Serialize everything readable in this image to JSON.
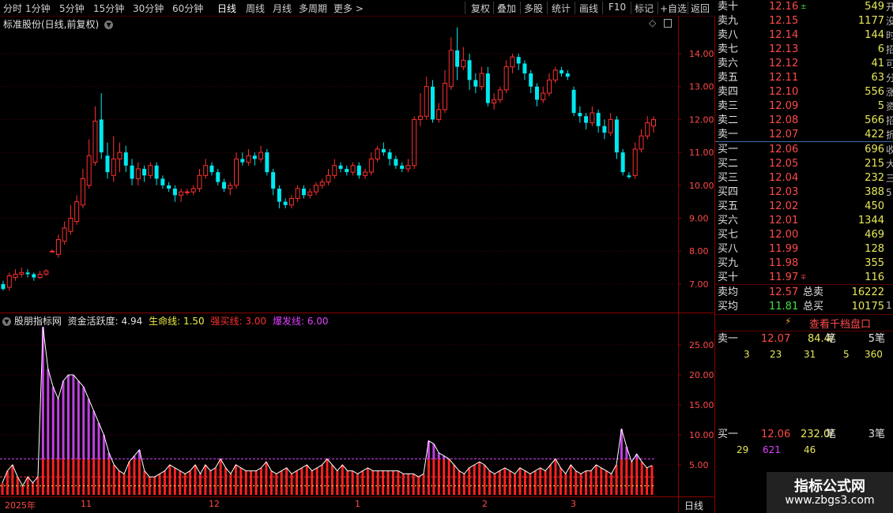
{
  "toolbar": {
    "periods": [
      "分时",
      "1分钟",
      "5分钟",
      "15分钟",
      "30分钟",
      "60分钟",
      "日线",
      "周线",
      "月线",
      "多周期",
      "更多"
    ],
    "active_period": "日线",
    "more_arrow": "chevron-right-icon",
    "actions": [
      "复权",
      "叠加",
      "多股",
      "统计",
      "画线",
      "F10",
      "标记",
      "+自选",
      "返回"
    ]
  },
  "main_chart": {
    "title": "标准股份(日线,前复权)",
    "y_ticks": [
      "14.00",
      "13.00",
      "12.00",
      "11.00",
      "10.00",
      "9.00",
      "8.00",
      "7.00"
    ]
  },
  "indicator": {
    "title": "股朋指标网",
    "fields": [
      {
        "label": "资金活跃度:",
        "value": "4.94",
        "color": "#e0e0e0"
      },
      {
        "label": "生命线:",
        "value": "1.50",
        "color": "#f0f040"
      },
      {
        "label": "强买线:",
        "value": "3.00",
        "color": "#ff3030"
      },
      {
        "label": "爆发线:",
        "value": "6.00",
        "color": "#e040ff"
      }
    ],
    "y_ticks": [
      "25.00",
      "20.00",
      "15.00",
      "10.00",
      "5.00"
    ]
  },
  "date_axis": {
    "labels": [
      "2025年",
      "11",
      "12",
      "1",
      "2",
      "3"
    ],
    "period_label": "日线"
  },
  "chart_data": {
    "type": "candlestick",
    "price_ylim": [
      6.5,
      14.8
    ],
    "candles": [
      [
        7.0,
        6.85,
        7.1,
        6.8
      ],
      [
        6.9,
        7.25,
        7.35,
        6.8
      ],
      [
        7.2,
        7.3,
        7.45,
        7.1
      ],
      [
        7.3,
        7.35,
        7.5,
        7.2
      ],
      [
        7.35,
        7.3,
        7.45,
        7.2
      ],
      [
        7.3,
        7.2,
        7.35,
        7.1
      ],
      [
        7.2,
        7.3,
        7.4,
        7.15
      ],
      [
        7.3,
        7.4,
        7.45,
        7.25
      ],
      [
        8.0,
        8.0,
        8.05,
        7.95
      ],
      [
        7.9,
        8.35,
        8.5,
        7.8
      ],
      [
        8.3,
        8.7,
        8.9,
        8.2
      ],
      [
        8.6,
        9.0,
        9.4,
        8.5
      ],
      [
        8.9,
        9.5,
        9.7,
        8.8
      ],
      [
        9.4,
        10.2,
        10.5,
        9.3
      ],
      [
        10.0,
        10.9,
        11.4,
        9.9
      ],
      [
        10.7,
        11.95,
        12.4,
        10.6
      ],
      [
        12.0,
        11.0,
        12.8,
        10.8
      ],
      [
        10.9,
        10.4,
        11.3,
        10.2
      ],
      [
        10.3,
        10.8,
        11.5,
        10.1
      ],
      [
        10.8,
        11.0,
        11.3,
        10.4
      ],
      [
        11.0,
        10.6,
        11.2,
        10.4
      ],
      [
        10.6,
        10.2,
        10.8,
        10.0
      ],
      [
        10.2,
        10.5,
        10.7,
        10.0
      ],
      [
        10.5,
        10.3,
        10.6,
        10.1
      ],
      [
        10.3,
        10.6,
        10.7,
        10.2
      ],
      [
        10.6,
        10.2,
        10.7,
        10.0
      ],
      [
        10.2,
        10.0,
        10.3,
        9.9
      ],
      [
        10.0,
        9.9,
        10.1,
        9.8
      ],
      [
        9.9,
        9.7,
        10.0,
        9.5
      ],
      [
        9.7,
        9.8,
        9.9,
        9.5
      ],
      [
        9.8,
        9.8,
        9.9,
        9.7
      ],
      [
        9.8,
        9.9,
        10.0,
        9.7
      ],
      [
        9.9,
        10.3,
        10.5,
        9.8
      ],
      [
        10.3,
        10.6,
        10.8,
        10.2
      ],
      [
        10.6,
        10.4,
        10.7,
        10.3
      ],
      [
        10.4,
        10.1,
        10.5,
        10.0
      ],
      [
        10.1,
        9.9,
        10.2,
        9.8
      ],
      [
        9.9,
        10.0,
        10.1,
        9.7
      ],
      [
        10.0,
        10.8,
        11.0,
        9.9
      ],
      [
        10.8,
        10.7,
        11.0,
        10.6
      ],
      [
        10.7,
        10.9,
        11.1,
        10.6
      ],
      [
        10.9,
        10.8,
        11.0,
        10.6
      ],
      [
        10.8,
        11.0,
        11.2,
        10.7
      ],
      [
        11.0,
        10.4,
        11.1,
        10.3
      ],
      [
        10.4,
        9.9,
        10.5,
        9.7
      ],
      [
        9.9,
        9.5,
        10.0,
        9.3
      ],
      [
        9.5,
        9.4,
        9.6,
        9.3
      ],
      [
        9.4,
        9.6,
        9.7,
        9.3
      ],
      [
        9.6,
        9.9,
        10.0,
        9.5
      ],
      [
        9.9,
        9.7,
        10.0,
        9.6
      ],
      [
        9.7,
        9.8,
        9.9,
        9.6
      ],
      [
        9.8,
        10.0,
        10.1,
        9.7
      ],
      [
        10.0,
        10.1,
        10.2,
        9.9
      ],
      [
        10.1,
        10.3,
        10.5,
        10.0
      ],
      [
        10.3,
        10.6,
        10.8,
        10.2
      ],
      [
        10.6,
        10.5,
        10.7,
        10.4
      ],
      [
        10.5,
        10.4,
        10.6,
        10.3
      ],
      [
        10.4,
        10.6,
        10.7,
        10.3
      ],
      [
        10.6,
        10.3,
        10.7,
        10.2
      ],
      [
        10.3,
        10.4,
        10.5,
        10.2
      ],
      [
        10.4,
        10.8,
        11.0,
        10.3
      ],
      [
        10.8,
        11.1,
        11.2,
        10.7
      ],
      [
        11.1,
        11.0,
        11.3,
        10.9
      ],
      [
        11.0,
        10.8,
        11.1,
        10.6
      ],
      [
        10.8,
        10.6,
        10.9,
        10.5
      ],
      [
        10.6,
        10.5,
        10.7,
        10.4
      ],
      [
        10.5,
        10.6,
        10.8,
        10.4
      ],
      [
        10.6,
        12.0,
        12.1,
        10.5
      ],
      [
        12.0,
        12.1,
        12.8,
        11.8
      ],
      [
        12.1,
        13.0,
        13.3,
        12.0
      ],
      [
        13.0,
        12.0,
        13.2,
        11.9
      ],
      [
        12.0,
        12.3,
        12.5,
        11.9
      ],
      [
        12.3,
        13.1,
        13.5,
        12.2
      ],
      [
        13.0,
        14.1,
        14.5,
        12.9
      ],
      [
        14.1,
        13.6,
        14.8,
        13.2
      ],
      [
        13.6,
        13.8,
        14.2,
        13.5
      ],
      [
        13.8,
        13.2,
        14.0,
        12.9
      ],
      [
        13.2,
        13.0,
        13.4,
        12.8
      ],
      [
        13.0,
        13.4,
        13.6,
        12.9
      ],
      [
        13.4,
        12.5,
        13.6,
        12.4
      ],
      [
        12.5,
        12.6,
        12.8,
        12.3
      ],
      [
        12.6,
        12.9,
        13.0,
        12.5
      ],
      [
        12.9,
        13.6,
        13.8,
        12.8
      ],
      [
        13.6,
        13.9,
        14.0,
        13.4
      ],
      [
        13.9,
        13.7,
        14.0,
        13.5
      ],
      [
        13.7,
        13.4,
        13.8,
        13.2
      ],
      [
        13.4,
        13.0,
        13.5,
        12.8
      ],
      [
        13.0,
        12.6,
        13.1,
        12.4
      ],
      [
        12.6,
        12.8,
        13.0,
        12.5
      ],
      [
        12.8,
        13.2,
        13.4,
        12.7
      ],
      [
        13.2,
        13.5,
        13.6,
        13.1
      ],
      [
        13.5,
        13.4,
        13.6,
        13.3
      ],
      [
        13.4,
        13.3,
        13.5,
        13.2
      ],
      [
        12.9,
        12.2,
        13.0,
        12.1
      ],
      [
        12.2,
        12.1,
        12.4,
        11.9
      ],
      [
        12.1,
        11.9,
        12.2,
        11.7
      ],
      [
        11.9,
        12.2,
        12.4,
        11.8
      ],
      [
        12.2,
        11.8,
        12.3,
        11.6
      ],
      [
        11.8,
        11.6,
        12.0,
        11.4
      ],
      [
        11.6,
        12.0,
        12.2,
        11.5
      ],
      [
        12.0,
        11.0,
        12.1,
        10.8
      ],
      [
        11.0,
        10.4,
        11.1,
        10.3
      ],
      [
        10.3,
        10.25,
        10.4,
        10.2
      ],
      [
        10.3,
        11.1,
        11.3,
        10.2
      ],
      [
        11.1,
        11.5,
        11.7,
        11.0
      ],
      [
        11.5,
        11.9,
        12.1,
        11.4
      ],
      [
        11.8,
        12.0,
        12.1,
        11.6
      ]
    ],
    "indicator_ylim": [
      0,
      30
    ],
    "indicator_values": [
      2,
      4,
      5,
      3,
      1.5,
      3,
      2,
      3,
      28,
      21,
      18,
      16,
      19,
      20,
      20,
      19,
      18,
      16,
      14,
      12,
      10,
      7,
      5,
      4,
      3.5,
      5.5,
      6.5,
      7.5,
      4,
      3,
      3,
      3.5,
      4,
      5,
      4.5,
      4,
      3.5,
      4,
      5,
      3.5,
      5,
      4,
      4.5,
      6,
      4.5,
      3.5,
      5,
      4.5,
      4,
      4,
      4,
      4.5,
      5.5,
      4,
      3.5,
      4,
      4.5,
      3.5,
      4,
      4.5,
      5,
      4,
      4.5,
      5,
      6,
      5,
      4,
      5,
      4,
      4,
      3.5,
      4,
      4.5,
      4,
      4,
      4,
      4,
      4,
      4,
      3.5,
      3.5,
      3.5,
      3,
      3.5,
      9,
      8.5,
      7,
      6.5,
      6,
      5,
      4,
      3.5,
      4.5,
      5,
      5.5,
      5,
      4,
      3.5,
      4,
      4.5,
      4,
      3.5,
      4.5,
      4,
      3.5,
      4,
      4.5,
      4,
      5,
      6,
      4.5,
      3.5,
      5,
      4,
      3.5,
      4,
      4,
      5,
      4.5,
      4,
      3.5,
      5,
      11,
      8,
      5.5,
      6.8,
      5.5,
      4.5,
      4.9
    ],
    "indicator_lines": {
      "生命线": 1.5,
      "强买线": 3.0,
      "爆发线": 6.0
    }
  },
  "orderbook": {
    "asks": [
      {
        "label": "卖十",
        "price": "12.16",
        "vol": "549",
        "mark": "±"
      },
      {
        "label": "卖九",
        "price": "12.15",
        "vol": "1177"
      },
      {
        "label": "卖八",
        "price": "12.14",
        "vol": "144"
      },
      {
        "label": "卖七",
        "price": "12.13",
        "vol": "6"
      },
      {
        "label": "卖六",
        "price": "12.12",
        "vol": "41"
      },
      {
        "label": "卖五",
        "price": "12.11",
        "vol": "63"
      },
      {
        "label": "卖四",
        "price": "12.10",
        "vol": "556"
      },
      {
        "label": "卖三",
        "price": "12.09",
        "vol": "5"
      },
      {
        "label": "卖二",
        "price": "12.08",
        "vol": "566"
      },
      {
        "label": "卖一",
        "price": "12.07",
        "vol": "422"
      }
    ],
    "bids": [
      {
        "label": "买一",
        "price": "12.06",
        "vol": "696"
      },
      {
        "label": "买二",
        "price": "12.05",
        "vol": "215"
      },
      {
        "label": "买三",
        "price": "12.04",
        "vol": "232"
      },
      {
        "label": "买四",
        "price": "12.03",
        "vol": "388"
      },
      {
        "label": "买五",
        "price": "12.02",
        "vol": "450"
      },
      {
        "label": "买六",
        "price": "12.01",
        "vol": "1344"
      },
      {
        "label": "买七",
        "price": "12.00",
        "vol": "469"
      },
      {
        "label": "买八",
        "price": "11.99",
        "vol": "128"
      },
      {
        "label": "买九",
        "price": "11.98",
        "vol": "355"
      },
      {
        "label": "买十",
        "price": "11.97",
        "vol": "116",
        "mark": "∓"
      }
    ],
    "edge_chars": [
      "开",
      "没",
      "时",
      "招",
      "可",
      "分",
      "涨",
      "资",
      "招",
      "折",
      "收",
      "大",
      "三",
      "5",
      "",
      "",
      "",
      "",
      "",
      "",
      "",
      "1"
    ],
    "avg_sell": {
      "label": "卖均",
      "price": "12.57",
      "total_label": "总卖",
      "total": "16222"
    },
    "avg_buy": {
      "label": "买均",
      "price": "11.81",
      "total_label": "总买",
      "total": "10175"
    },
    "qiandang_link": "查看千档盘口",
    "sell1": {
      "label": "卖一",
      "price": "12.07",
      "per": "84.4/",
      "unit": "笔",
      "count": "5笔",
      "queue": [
        "3",
        "23",
        "31",
        "5",
        "360"
      ]
    },
    "buy1": {
      "label": "买一",
      "price": "12.06",
      "per": "232.0/",
      "unit": "笔",
      "count": "3笔",
      "queue": [
        "29",
        "621",
        "46"
      ]
    }
  },
  "watermark": {
    "line1": "指标公式网",
    "line2": "www.zbgs3.com"
  }
}
